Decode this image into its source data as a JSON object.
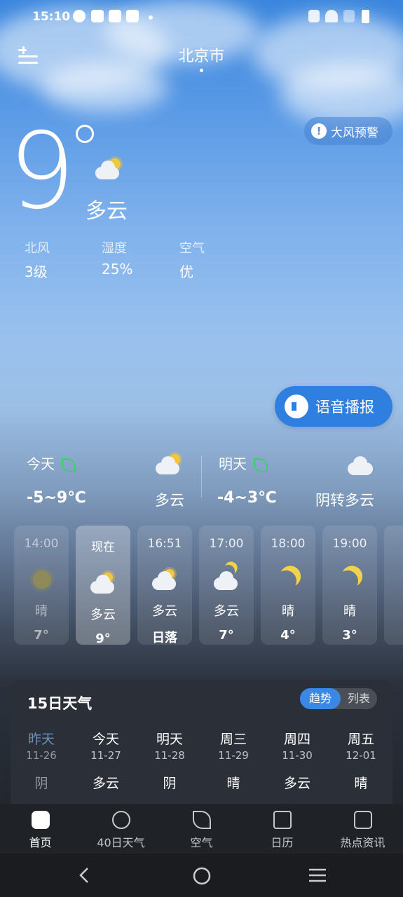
{
  "status_bar": {
    "time": "15:10"
  },
  "header": {
    "city": "北京市"
  },
  "alert": {
    "label": "大风预警",
    "icon": "!"
  },
  "current": {
    "temperature": "9",
    "condition": "多云",
    "details": [
      {
        "label": "北风",
        "value": "3级"
      },
      {
        "label": "湿度",
        "value": "25%"
      },
      {
        "label": "空气",
        "value": "优"
      }
    ]
  },
  "voice": {
    "label": "语音播报"
  },
  "days": [
    {
      "label": "今天",
      "range": "-5~9℃",
      "condition": "多云"
    },
    {
      "label": "明天",
      "range": "-4~3℃",
      "condition": "阴转多云"
    }
  ],
  "hourly": [
    {
      "time": "14:00",
      "cond": "晴",
      "value": "7°",
      "icon": "sun-icon"
    },
    {
      "time": "现在",
      "cond": "多云",
      "value": "9°",
      "icon": "partly-cloudy-icon"
    },
    {
      "time": "16:51",
      "cond": "多云",
      "value": "日落",
      "icon": "partly-cloudy-icon"
    },
    {
      "time": "17:00",
      "cond": "多云",
      "value": "7°",
      "icon": "cloudy-night-icon"
    },
    {
      "time": "18:00",
      "cond": "晴",
      "value": "4°",
      "icon": "moon-icon"
    },
    {
      "time": "19:00",
      "cond": "晴",
      "value": "3°",
      "icon": "moon-icon"
    }
  ],
  "forecast15": {
    "title": "15日天气",
    "toggle": {
      "trend": "趋势",
      "list": "列表"
    },
    "days": [
      {
        "name": "昨天",
        "date": "11-26",
        "cond": "阴"
      },
      {
        "name": "今天",
        "date": "11-27",
        "cond": "多云"
      },
      {
        "name": "明天",
        "date": "11-28",
        "cond": "阴"
      },
      {
        "name": "周三",
        "date": "11-29",
        "cond": "晴"
      },
      {
        "name": "周四",
        "date": "11-30",
        "cond": "多云"
      },
      {
        "name": "周五",
        "date": "12-01",
        "cond": "晴"
      }
    ]
  },
  "tabs": [
    {
      "label": "首页",
      "icon": "home-icon"
    },
    {
      "label": "40日天气",
      "icon": "cloud-icon"
    },
    {
      "label": "空气",
      "icon": "leaf-icon"
    },
    {
      "label": "日历",
      "icon": "calendar-icon"
    },
    {
      "label": "热点资讯",
      "icon": "news-icon"
    }
  ],
  "colors": {
    "accent": "#3b87e6",
    "leaf": "#3fcf6a",
    "sun": "#f3c73a"
  }
}
